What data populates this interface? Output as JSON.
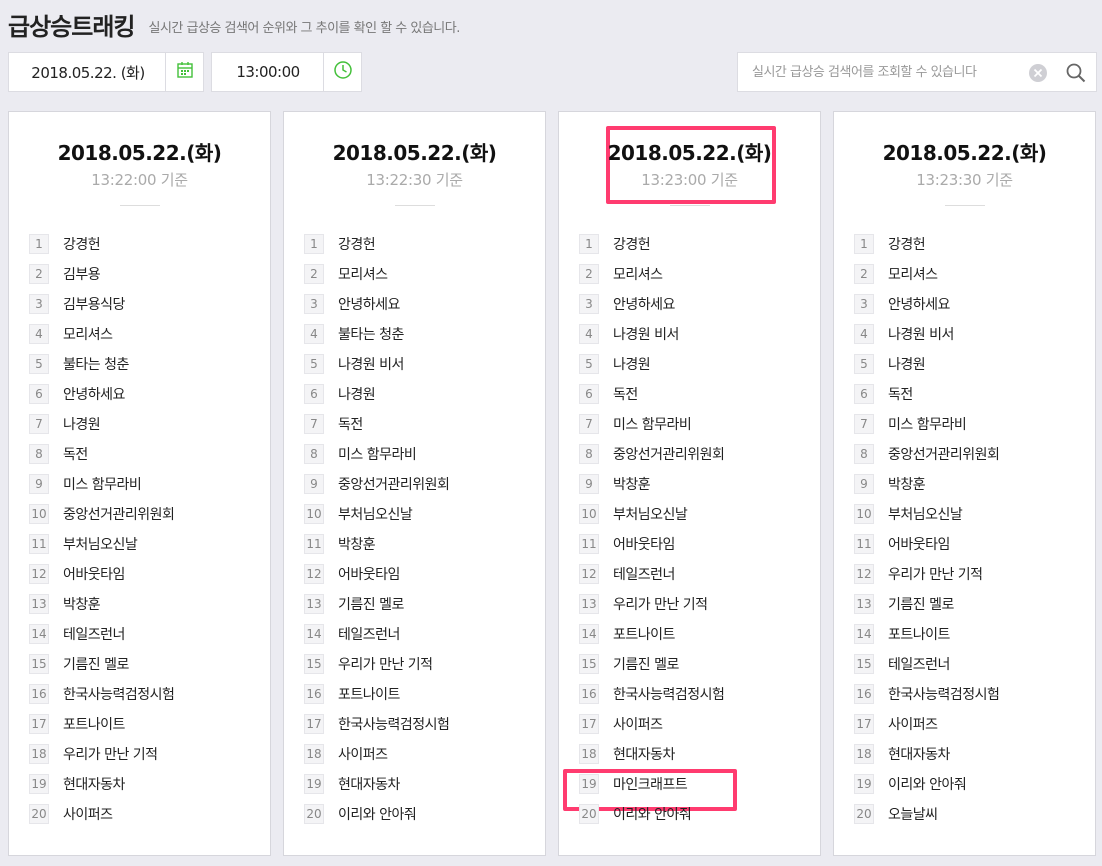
{
  "header": {
    "title": "급상승트래킹",
    "subtitle": "실시간 급상승 검색어 순위와 그 추이를 확인 할 수 있습니다."
  },
  "controls": {
    "date": "2018.05.22. (화)",
    "time": "13:00:00",
    "search_placeholder": "실시간 급상승 검색어를 조회할 수 있습니다",
    "search_value": ""
  },
  "icons": {
    "calendar": "calendar-icon",
    "clock": "clock-icon",
    "clear": "clear-icon",
    "search": "search-icon"
  },
  "colors": {
    "accent_green": "#43c03a",
    "highlight_pink": "#ff3b6f"
  },
  "panels": [
    {
      "date": "2018.05.22.(화)",
      "time": "13:22:00 기준",
      "highlighted": false,
      "items": [
        {
          "rank": "1",
          "keyword": "강경헌"
        },
        {
          "rank": "2",
          "keyword": "김부용"
        },
        {
          "rank": "3",
          "keyword": "김부용식당"
        },
        {
          "rank": "4",
          "keyword": "모리셔스"
        },
        {
          "rank": "5",
          "keyword": "불타는 청춘"
        },
        {
          "rank": "6",
          "keyword": "안녕하세요"
        },
        {
          "rank": "7",
          "keyword": "나경원"
        },
        {
          "rank": "8",
          "keyword": "독전"
        },
        {
          "rank": "9",
          "keyword": "미스 함무라비"
        },
        {
          "rank": "10",
          "keyword": "중앙선거관리위원회"
        },
        {
          "rank": "11",
          "keyword": "부처님오신날"
        },
        {
          "rank": "12",
          "keyword": "어바웃타임"
        },
        {
          "rank": "13",
          "keyword": "박창훈"
        },
        {
          "rank": "14",
          "keyword": "테일즈런너"
        },
        {
          "rank": "15",
          "keyword": "기름진 멜로"
        },
        {
          "rank": "16",
          "keyword": "한국사능력검정시험"
        },
        {
          "rank": "17",
          "keyword": "포트나이트"
        },
        {
          "rank": "18",
          "keyword": "우리가 만난 기적"
        },
        {
          "rank": "19",
          "keyword": "현대자동차"
        },
        {
          "rank": "20",
          "keyword": "사이퍼즈"
        }
      ]
    },
    {
      "date": "2018.05.22.(화)",
      "time": "13:22:30 기준",
      "highlighted": false,
      "items": [
        {
          "rank": "1",
          "keyword": "강경헌"
        },
        {
          "rank": "2",
          "keyword": "모리셔스"
        },
        {
          "rank": "3",
          "keyword": "안녕하세요"
        },
        {
          "rank": "4",
          "keyword": "불타는 청춘"
        },
        {
          "rank": "5",
          "keyword": "나경원 비서"
        },
        {
          "rank": "6",
          "keyword": "나경원"
        },
        {
          "rank": "7",
          "keyword": "독전"
        },
        {
          "rank": "8",
          "keyword": "미스 함무라비"
        },
        {
          "rank": "9",
          "keyword": "중앙선거관리위원회"
        },
        {
          "rank": "10",
          "keyword": "부처님오신날"
        },
        {
          "rank": "11",
          "keyword": "박창훈"
        },
        {
          "rank": "12",
          "keyword": "어바웃타임"
        },
        {
          "rank": "13",
          "keyword": "기름진 멜로"
        },
        {
          "rank": "14",
          "keyword": "테일즈런너"
        },
        {
          "rank": "15",
          "keyword": "우리가 만난 기적"
        },
        {
          "rank": "16",
          "keyword": "포트나이트"
        },
        {
          "rank": "17",
          "keyword": "한국사능력검정시험"
        },
        {
          "rank": "18",
          "keyword": "사이퍼즈"
        },
        {
          "rank": "19",
          "keyword": "현대자동차"
        },
        {
          "rank": "20",
          "keyword": "이리와 안아줘"
        }
      ]
    },
    {
      "date": "2018.05.22.(화)",
      "time": "13:23:00 기준",
      "highlighted": true,
      "items": [
        {
          "rank": "1",
          "keyword": "강경헌"
        },
        {
          "rank": "2",
          "keyword": "모리셔스"
        },
        {
          "rank": "3",
          "keyword": "안녕하세요"
        },
        {
          "rank": "4",
          "keyword": "나경원 비서"
        },
        {
          "rank": "5",
          "keyword": "나경원"
        },
        {
          "rank": "6",
          "keyword": "독전"
        },
        {
          "rank": "7",
          "keyword": "미스 함무라비"
        },
        {
          "rank": "8",
          "keyword": "중앙선거관리위원회"
        },
        {
          "rank": "9",
          "keyword": "박창훈"
        },
        {
          "rank": "10",
          "keyword": "부처님오신날"
        },
        {
          "rank": "11",
          "keyword": "어바웃타임"
        },
        {
          "rank": "12",
          "keyword": "테일즈런너"
        },
        {
          "rank": "13",
          "keyword": "우리가 만난 기적"
        },
        {
          "rank": "14",
          "keyword": "포트나이트"
        },
        {
          "rank": "15",
          "keyword": "기름진 멜로"
        },
        {
          "rank": "16",
          "keyword": "한국사능력검정시험"
        },
        {
          "rank": "17",
          "keyword": "사이퍼즈"
        },
        {
          "rank": "18",
          "keyword": "현대자동차"
        },
        {
          "rank": "19",
          "keyword": "마인크래프트",
          "highlighted": true
        },
        {
          "rank": "20",
          "keyword": "이리와 안아줘"
        }
      ]
    },
    {
      "date": "2018.05.22.(화)",
      "time": "13:23:30 기준",
      "highlighted": false,
      "items": [
        {
          "rank": "1",
          "keyword": "강경헌"
        },
        {
          "rank": "2",
          "keyword": "모리셔스"
        },
        {
          "rank": "3",
          "keyword": "안녕하세요"
        },
        {
          "rank": "4",
          "keyword": "나경원 비서"
        },
        {
          "rank": "5",
          "keyword": "나경원"
        },
        {
          "rank": "6",
          "keyword": "독전"
        },
        {
          "rank": "7",
          "keyword": "미스 함무라비"
        },
        {
          "rank": "8",
          "keyword": "중앙선거관리위원회"
        },
        {
          "rank": "9",
          "keyword": "박창훈"
        },
        {
          "rank": "10",
          "keyword": "부처님오신날"
        },
        {
          "rank": "11",
          "keyword": "어바웃타임"
        },
        {
          "rank": "12",
          "keyword": "우리가 만난 기적"
        },
        {
          "rank": "13",
          "keyword": "기름진 멜로"
        },
        {
          "rank": "14",
          "keyword": "포트나이트"
        },
        {
          "rank": "15",
          "keyword": "테일즈런너"
        },
        {
          "rank": "16",
          "keyword": "한국사능력검정시험"
        },
        {
          "rank": "17",
          "keyword": "사이퍼즈"
        },
        {
          "rank": "18",
          "keyword": "현대자동차"
        },
        {
          "rank": "19",
          "keyword": "이리와 안아줘"
        },
        {
          "rank": "20",
          "keyword": "오늘날씨"
        }
      ]
    }
  ]
}
